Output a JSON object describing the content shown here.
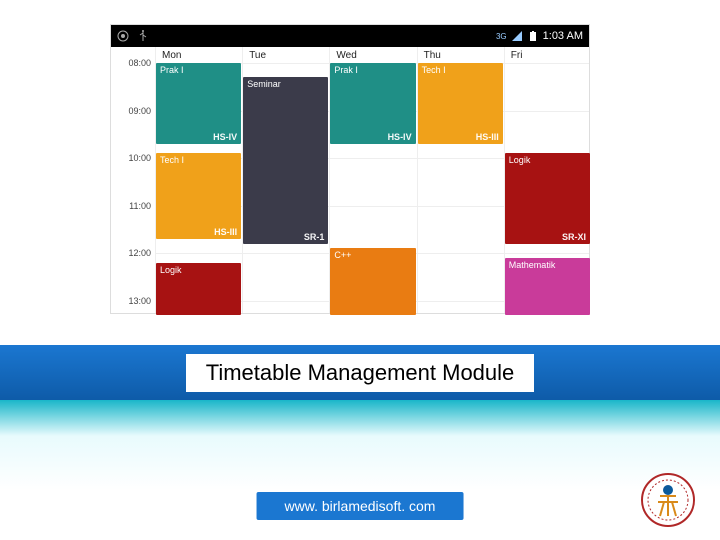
{
  "status_bar": {
    "network_label": "3G",
    "time": "1:03 AM"
  },
  "days": [
    "Mon",
    "Tue",
    "Wed",
    "Thu",
    "Fri"
  ],
  "times": [
    "08:00",
    "09:00",
    "10:00",
    "11:00",
    "12:00",
    "13:00"
  ],
  "events": [
    {
      "day": 0,
      "start": 8.0,
      "end": 9.7,
      "title": "Prak I",
      "room": "HS-IV",
      "color": "#1f8f86"
    },
    {
      "day": 0,
      "start": 9.9,
      "end": 11.7,
      "title": "Tech I",
      "room": "HS-III",
      "color": "#f0a11a"
    },
    {
      "day": 0,
      "start": 12.2,
      "end": 13.3,
      "title": "Logik",
      "room": "",
      "color": "#a71212"
    },
    {
      "day": 1,
      "start": 8.3,
      "end": 11.8,
      "title": "Seminar",
      "room": "SR-1",
      "color": "#3b3b4a"
    },
    {
      "day": 2,
      "start": 8.0,
      "end": 9.7,
      "title": "Prak I",
      "room": "HS-IV",
      "color": "#1f8f86"
    },
    {
      "day": 2,
      "start": 11.9,
      "end": 13.3,
      "title": "C++",
      "room": "",
      "color": "#e97c12"
    },
    {
      "day": 3,
      "start": 8.0,
      "end": 9.7,
      "title": "Tech I",
      "room": "HS-III",
      "color": "#f0a11a"
    },
    {
      "day": 4,
      "start": 9.9,
      "end": 11.8,
      "title": "Logik",
      "room": "SR-XI",
      "color": "#a71212"
    },
    {
      "day": 4,
      "start": 12.1,
      "end": 13.3,
      "title": "Mathematik",
      "room": "",
      "color": "#c93b9a"
    }
  ],
  "title": "Timetable Management Module",
  "footer_url": "www. birlamedisoft. com"
}
